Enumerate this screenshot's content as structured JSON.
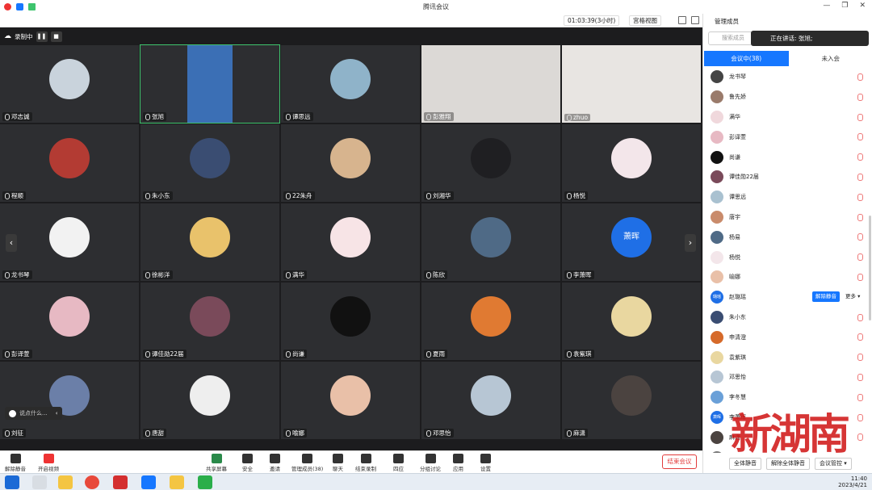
{
  "window": {
    "title": "腾讯会议",
    "panel_title": "管理成员"
  },
  "toolbar": {
    "timer": "01:03:39(3小时)",
    "view_mode": "宫格视图"
  },
  "recording": {
    "label": "录制中",
    "pause": "❚❚",
    "stop": "■"
  },
  "tiles": [
    {
      "name": "邓志诚",
      "color": "#c9d3dc"
    },
    {
      "name": "张旭",
      "color": "#5b8fd6"
    },
    {
      "name": "谭思远",
      "color": "#8fb3c9"
    },
    {
      "name": "彭雅翔",
      "color": "#d8d5d2"
    },
    {
      "name": "zhuo",
      "color": "#e2dfdc"
    },
    {
      "name": "程顺",
      "color": "#b33b33"
    },
    {
      "name": "朱小东",
      "color": "#3a4d72"
    },
    {
      "name": "22朱舟",
      "color": "#d7b48e"
    },
    {
      "name": "刘湘华",
      "color": "#1f1f22"
    },
    {
      "name": "杨悦",
      "color": "#f3e6ea"
    },
    {
      "name": "龙书琴",
      "color": "#f2f2f2"
    },
    {
      "name": "徐彬洋",
      "color": "#e9c26b"
    },
    {
      "name": "满华",
      "color": "#f7e4e6"
    },
    {
      "name": "陈欣",
      "color": "#4f6a86"
    },
    {
      "name": "李萧晖",
      "color": "#1f6fe6",
      "initial": "萧晖"
    },
    {
      "name": "彭译萱",
      "color": "#e7b9c3"
    },
    {
      "name": "谭佳勋22届",
      "color": "#7a4a5a"
    },
    {
      "name": "尚谦",
      "color": "#111111"
    },
    {
      "name": "夏雨",
      "color": "#e07a32"
    },
    {
      "name": "袁紫琪",
      "color": "#e9d7a0"
    },
    {
      "name": "刘征",
      "color": "#6b7fa8"
    },
    {
      "name": "唐甜",
      "color": "#eeeeee"
    },
    {
      "name": "喻娜",
      "color": "#e9c0a8"
    },
    {
      "name": "邓思怡",
      "color": "#b7c6d4"
    },
    {
      "name": "麻潇",
      "color": "#4b4340"
    }
  ],
  "chat_placeholder": "说点什么...",
  "bottom_bar": {
    "unmute": "解除静音",
    "video": "开启视频",
    "share": "共享屏幕",
    "security": "安全",
    "invite": "邀请",
    "members": "管理成员(38)",
    "chat": "聊天",
    "record": "结束录制",
    "reactions": "四应",
    "breakout": "分组讨论",
    "apps": "应用",
    "settings": "设置",
    "end": "结束会议"
  },
  "panel": {
    "search_placeholder": "搜索成员",
    "speaking": "正在讲话: 张旭;",
    "tab_in_meeting": "会议中(38)",
    "tab_not_joined": "未入会",
    "members": [
      {
        "name": "龙书琴",
        "color": "#444"
      },
      {
        "name": "鲁先娇",
        "color": "#9a7b6b"
      },
      {
        "name": "满华",
        "color": "#f0d8dc"
      },
      {
        "name": "彭译萱",
        "color": "#e7b9c3"
      },
      {
        "name": "尚谦",
        "color": "#111"
      },
      {
        "name": "谭佳勋22届",
        "color": "#7a4a5a"
      },
      {
        "name": "谭思远",
        "color": "#a9c1d0"
      },
      {
        "name": "唐宇",
        "color": "#c98b6b"
      },
      {
        "name": "杨易",
        "color": "#4f6a86"
      },
      {
        "name": "杨悦",
        "color": "#f3e6ea"
      },
      {
        "name": "喻娜",
        "color": "#e9c0a8"
      },
      {
        "name": "赵璐瑶",
        "color": "#1f6fe6",
        "initial": "璐瑶"
      },
      {
        "name": "朱小东",
        "color": "#3a4d72"
      },
      {
        "name": "申清澄",
        "color": "#d66a2a"
      },
      {
        "name": "袁紫琪",
        "color": "#e9d7a0"
      },
      {
        "name": "邓思怡",
        "color": "#b7c6d4"
      },
      {
        "name": "李冬慧",
        "color": "#6aa0d8"
      },
      {
        "name": "李萧晖",
        "color": "#1f6fe6",
        "initial": "萧晖"
      },
      {
        "name": "麻潇",
        "color": "#4b4340"
      },
      {
        "name": "王",
        "color": "#777"
      }
    ],
    "unmute_label": "解除静音",
    "more_label": "更多 ▾",
    "mute_all": "全体静音",
    "unmute_all": "解除全体静音",
    "meeting_control": "会议管控 ▾"
  },
  "taskbar": {
    "clock_time": "11:40",
    "clock_date": "2023/4/21"
  },
  "watermark": "新湖南"
}
